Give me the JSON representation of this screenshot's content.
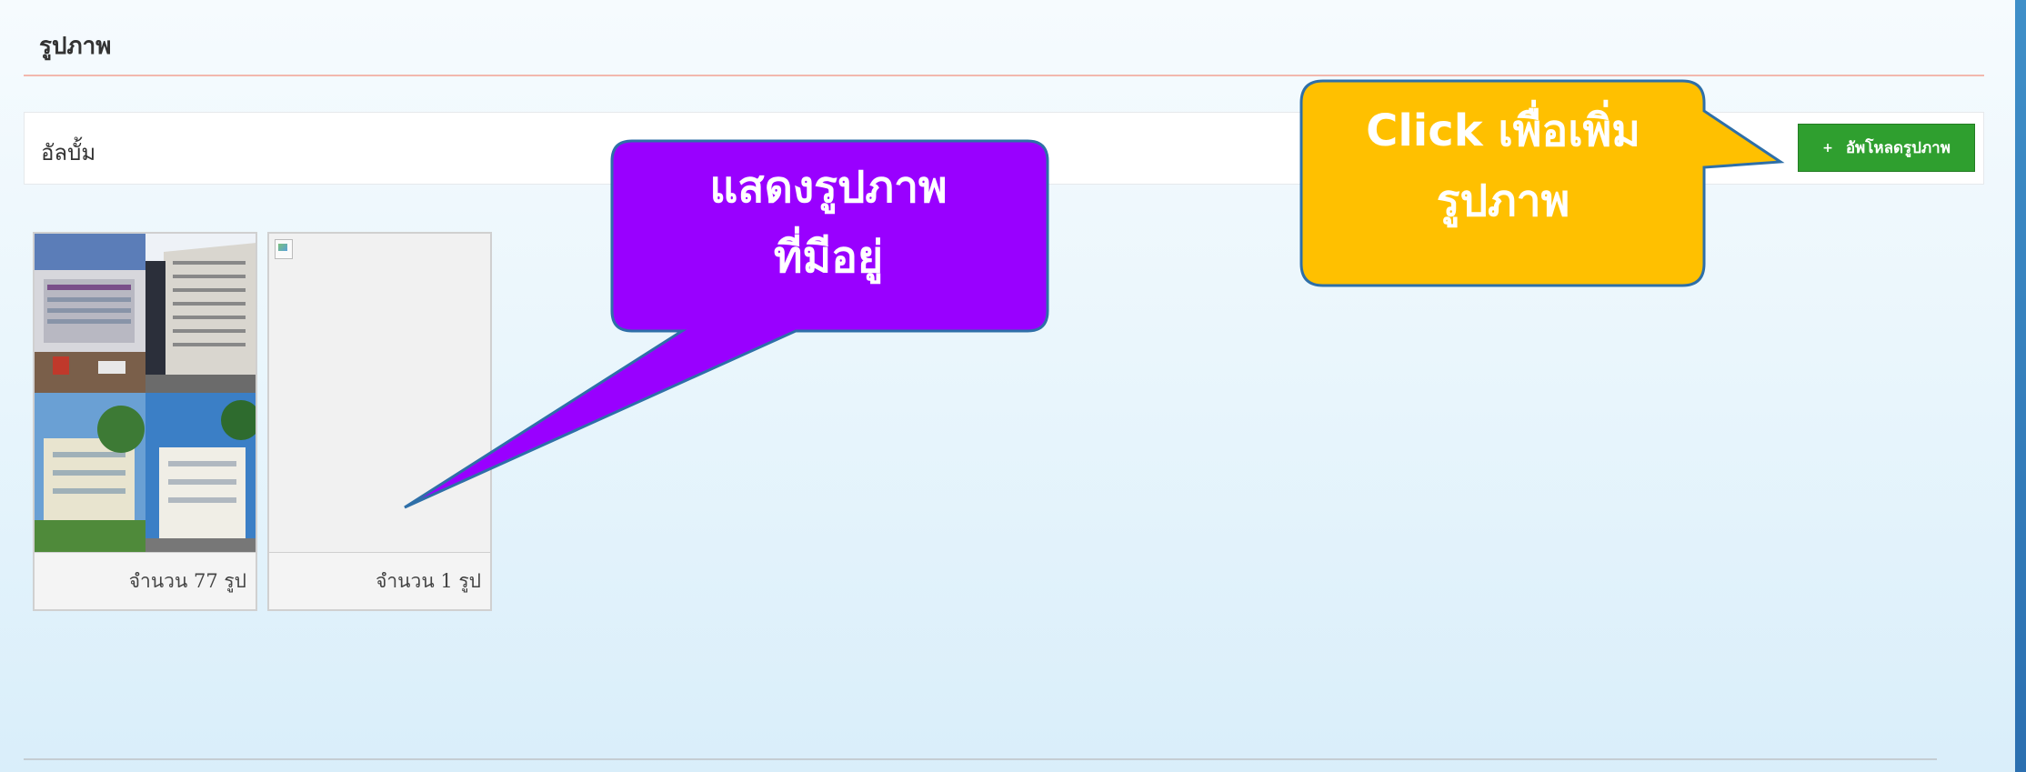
{
  "page": {
    "title": "รูปภาพ"
  },
  "album_bar": {
    "label": "อัลบั้ม",
    "upload_button": {
      "icon": "plus-icon",
      "label": "อัพโหลดรูปภาพ"
    }
  },
  "albums": [
    {
      "count_text": "จำนวน 77 รูป",
      "thumbnail": "photo-collage"
    },
    {
      "count_text": "จำนวน 1 รูป",
      "thumbnail": "broken-image-icon"
    }
  ],
  "annotations": {
    "purple_callout": {
      "line1": "แสดงรูปภาพ",
      "line2": "ที่มีอยู่",
      "color": "#9900ff"
    },
    "yellow_callout": {
      "line1": "Click เพื่อเพิ่ม",
      "line2": "รูปภาพ",
      "color": "#ffc000"
    }
  },
  "colors": {
    "upload_button": "#2f9f2f",
    "title_rule": "#f2b8ae"
  }
}
